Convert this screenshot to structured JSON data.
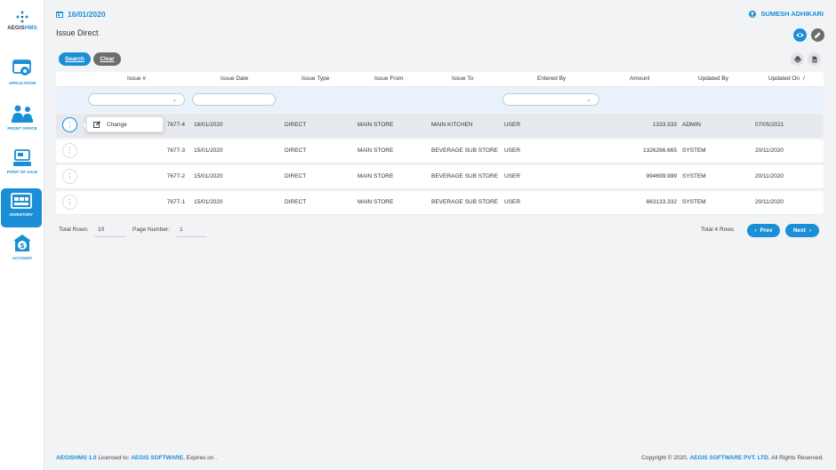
{
  "app": {
    "logo_prefix": "AEGIS",
    "logo_suffix": "HMS"
  },
  "sidebar": {
    "items": [
      {
        "label": "APPLICATION",
        "icon": "application-settings-icon"
      },
      {
        "label": "FRONT OFFICE",
        "icon": "front-office-icon"
      },
      {
        "label": "POINT OF SALE",
        "icon": "point-of-sale-icon"
      },
      {
        "label": "INVENTORY",
        "icon": "inventory-icon",
        "active": true
      },
      {
        "label": "ACCOUNT",
        "icon": "account-dollar-icon"
      }
    ]
  },
  "header": {
    "date": "16/01/2020",
    "user": "SUMESH ADHIKARI",
    "page_title": "Issue Direct"
  },
  "toolbar": {
    "search_label": "Search",
    "clear_label": "Clear"
  },
  "table": {
    "columns": {
      "issue_no": "Issue #",
      "issue_date": "Issue Date",
      "issue_type": "Issue Type",
      "issue_from": "Issue From",
      "issue_to": "Issue To",
      "entered_by": "Entered By",
      "amount": "Amount",
      "updated_by": "Updated By",
      "updated_on": "Updated On"
    },
    "sort_indicator": "/",
    "rows": [
      {
        "issue_no": "7677-4",
        "issue_date": "16/01/2020",
        "issue_type": "DIRECT",
        "issue_from": "MAIN STORE",
        "issue_to": "MAIN KITCHEN",
        "entered_by": "USER",
        "amount": "1333.333",
        "updated_by": "ADMIN",
        "updated_on": "07/05/2021"
      },
      {
        "issue_no": "7677-3",
        "issue_date": "15/01/2020",
        "issue_type": "DIRECT",
        "issue_from": "MAIN STORE",
        "issue_to": "BEVERAGE SUB STORE",
        "entered_by": "USER",
        "amount": "1326266.665",
        "updated_by": "SYSTEM",
        "updated_on": "20/11/2020"
      },
      {
        "issue_no": "7677-2",
        "issue_date": "15/01/2020",
        "issue_type": "DIRECT",
        "issue_from": "MAIN STORE",
        "issue_to": "BEVERAGE SUB STORE",
        "entered_by": "USER",
        "amount": "994699.999",
        "updated_by": "SYSTEM",
        "updated_on": "20/11/2020"
      },
      {
        "issue_no": "7677-1",
        "issue_date": "15/01/2020",
        "issue_type": "DIRECT",
        "issue_from": "MAIN STORE",
        "issue_to": "BEVERAGE SUB STORE",
        "entered_by": "USER",
        "amount": "663133.332",
        "updated_by": "SYSTEM",
        "updated_on": "20/11/2020"
      }
    ]
  },
  "context_menu": {
    "change_label": "Change"
  },
  "pagination": {
    "total_rows_label": "Total Rows:",
    "total_rows_value": "10",
    "page_number_label": "Page Number:",
    "page_number_value": "1",
    "total_summary": "Total 4 Rows",
    "prev_label": "Prev",
    "next_label": "Next"
  },
  "footer": {
    "product": "AEGISHMS 1.0",
    "licensed_text": " Licensed to: ",
    "licensee": "AEGIS SOFTWARE",
    "expires_text": ", Expires on .",
    "copyright_text": "Copyright © 2020, ",
    "company": "AEGIS SOFTWARE PVT. LTD.",
    "rights_text": " All Rights Reserved."
  },
  "colors": {
    "accent": "#1a8fd6",
    "grey_button": "#6d6d6d",
    "filter_bg": "#e9f2fb"
  }
}
